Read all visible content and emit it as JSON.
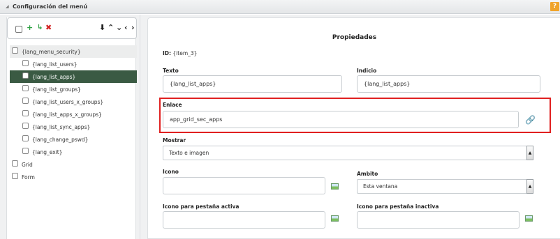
{
  "window": {
    "title": "Configuración del menú",
    "help_label": "?"
  },
  "toolbar": {
    "icons": [
      "checkbox-icon",
      "plus-icon",
      "indent-icon",
      "delete-icon",
      "download-icon",
      "up-icon",
      "down-icon",
      "left-icon",
      "right-icon"
    ],
    "glyphs": {
      "plus": "+",
      "indent": "↳",
      "delete": "✖",
      "download": "⬇",
      "up": "⌃",
      "down": "⌄",
      "left": "‹",
      "right": "›"
    }
  },
  "tree": {
    "items": [
      {
        "label": "{lang_menu_security}",
        "level": 0,
        "selected": false
      },
      {
        "label": "{lang_list_users}",
        "level": 1,
        "selected": false
      },
      {
        "label": "{lang_list_apps}",
        "level": 1,
        "selected": true
      },
      {
        "label": "{lang_list_groups}",
        "level": 1,
        "selected": false
      },
      {
        "label": "{lang_list_users_x_groups}",
        "level": 1,
        "selected": false
      },
      {
        "label": "{lang_list_apps_x_groups}",
        "level": 1,
        "selected": false
      },
      {
        "label": "{lang_list_sync_apps}",
        "level": 1,
        "selected": false
      },
      {
        "label": "{lang_change_pswd}",
        "level": 1,
        "selected": false
      },
      {
        "label": "{lang_exit}",
        "level": 1,
        "selected": false
      },
      {
        "label": "Grid",
        "level": 0,
        "selected": false
      },
      {
        "label": "Form",
        "level": 0,
        "selected": false
      }
    ]
  },
  "properties": {
    "title": "Propiedades",
    "id_label": "ID:",
    "id_value": "{item_3}",
    "texto": {
      "label": "Texto",
      "value": "{lang_list_apps}"
    },
    "indicio": {
      "label": "Indicio",
      "value": "{lang_list_apps}"
    },
    "enlace": {
      "label": "Enlace",
      "value": "app_grid_sec_apps"
    },
    "mostrar": {
      "label": "Mostrar",
      "value": "Texto e imagen"
    },
    "icono": {
      "label": "Icono",
      "value": ""
    },
    "ambito": {
      "label": "Ambito",
      "value": "Esta ventana"
    },
    "icono_activa": {
      "label": "Icono para pestaña activa",
      "value": ""
    },
    "icono_inactiva": {
      "label": "Icono para pestaña inactiva",
      "value": ""
    }
  },
  "colors": {
    "highlight": "#e02020",
    "selected_row": "#3a5a43",
    "accent_plus": "#2ea043",
    "accent_delete": "#d21f1f",
    "help": "#f0a42a"
  }
}
